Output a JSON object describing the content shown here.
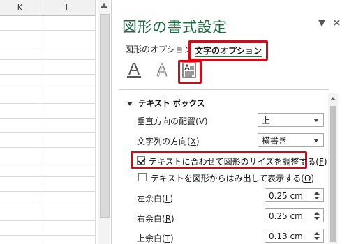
{
  "sheet": {
    "columns": [
      "K",
      "L"
    ]
  },
  "pane": {
    "title": "図形の書式設定",
    "tabs": {
      "shape_options": "図形のオプション",
      "text_options": "文字のオプション"
    },
    "icons": [
      "text-fill-outline-icon",
      "text-effects-icon",
      "textbox-icon"
    ],
    "section": {
      "title": "テキスト ボックス"
    },
    "vertical_alignment": {
      "label": "垂直方向の配置(",
      "key": "V",
      "label_end": ")",
      "value": "上"
    },
    "text_direction": {
      "label": "文字列の方向(",
      "key": "X",
      "label_end": ")",
      "value": "横書き"
    },
    "autofit": {
      "label": "テキストに合わせて図形のサイズを調整する(",
      "key": "F",
      "label_end": ")",
      "checked": true
    },
    "allow_overflow": {
      "label": "テキストを図形からはみ出して表示する(",
      "key": "O",
      "label_end": ")",
      "checked": false
    },
    "left_margin": {
      "label": "左余白(",
      "key": "L",
      "label_end": ")",
      "value": "0.25 cm"
    },
    "right_margin": {
      "label": "右余白(",
      "key": "R",
      "label_end": ")",
      "value": "0.25 cm"
    },
    "top_margin": {
      "label": "上余白(",
      "key": "T",
      "label_end": ")",
      "value": "0.13 cm"
    }
  },
  "colors": {
    "title_green": "#1e6b42",
    "highlight_red": "#e60012",
    "tab_underline": "#217346"
  }
}
